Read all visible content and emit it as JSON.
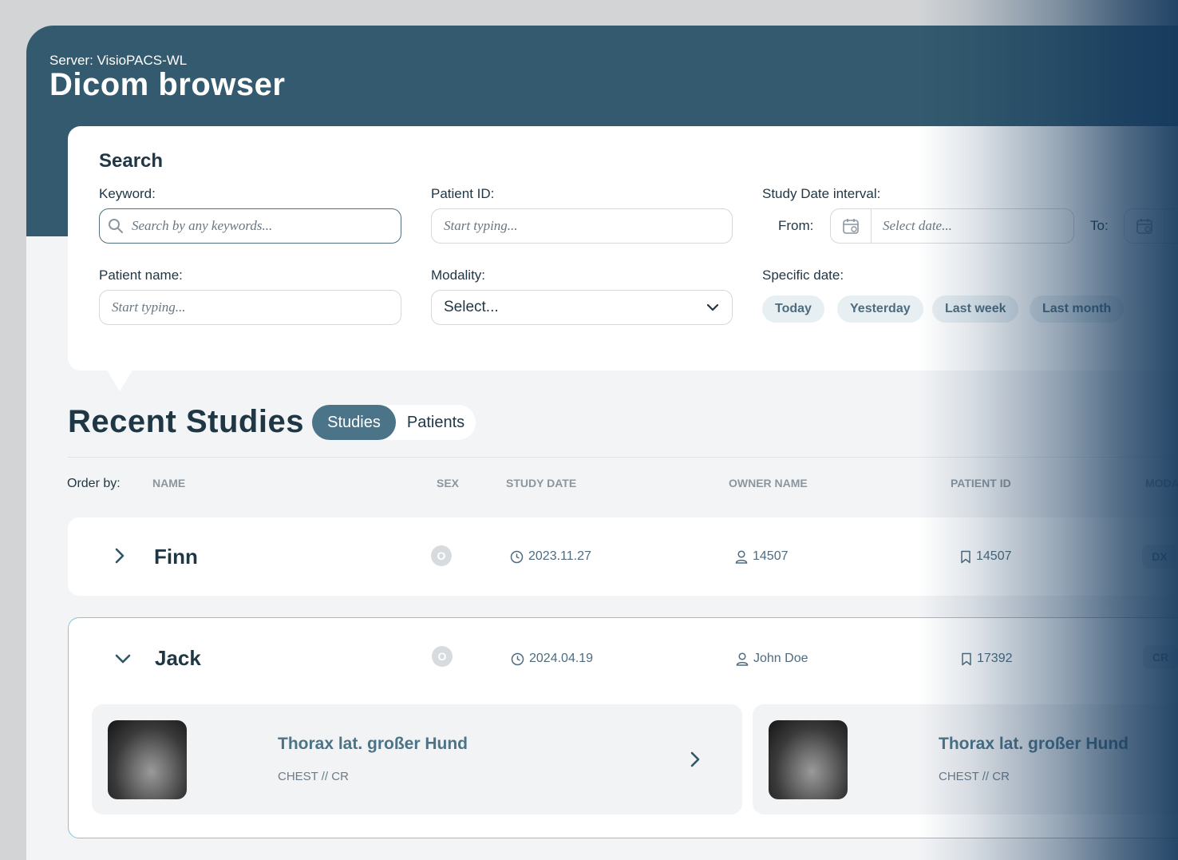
{
  "header": {
    "server_label": "Server: VisioPACS-WL",
    "title": "Dicom browser"
  },
  "search": {
    "title": "Search",
    "keyword_label": "Keyword:",
    "keyword_placeholder": "Search by any keywords...",
    "patient_id_label": "Patient ID:",
    "patient_id_placeholder": "Start typing...",
    "date_interval_label": "Study Date interval:",
    "from_label": "From:",
    "from_placeholder": "Select date...",
    "to_label": "To:",
    "patient_name_label": "Patient name:",
    "patient_name_placeholder": "Start typing...",
    "modality_label": "Modality:",
    "modality_value": "Select...",
    "specific_date_label": "Specific date:",
    "chips": [
      "Today",
      "Yesterday",
      "Last week",
      "Last month"
    ]
  },
  "recent": {
    "title": "Recent Studies",
    "toggle": {
      "studies": "Studies",
      "patients": "Patients",
      "active": "Studies"
    }
  },
  "table": {
    "order_by_label": "Order by:",
    "columns": [
      "NAME",
      "SEX",
      "STUDY DATE",
      "OWNER NAME",
      "PATIENT ID",
      "MODA"
    ]
  },
  "studies": [
    {
      "name": "Finn",
      "sex": "O",
      "study_date": "2023.11.27",
      "owner": "14507",
      "patient_id": "14507",
      "modality": "DX",
      "expanded": false
    },
    {
      "name": "Jack",
      "sex": "O",
      "study_date": "2024.04.19",
      "owner": "John Doe",
      "patient_id": "17392",
      "modality": "CR",
      "expanded": true,
      "series": [
        {
          "title": "Thorax lat. großer Hund",
          "subtitle": "CHEST // CR"
        },
        {
          "title": "Thorax lat. großer Hund",
          "subtitle": "CHEST // CR"
        }
      ]
    }
  ],
  "colors": {
    "header_bg": "#335a6e",
    "accent": "#4b7488",
    "chip_bg": "#e7eff3",
    "expanded_border": "#8fc0d6"
  }
}
